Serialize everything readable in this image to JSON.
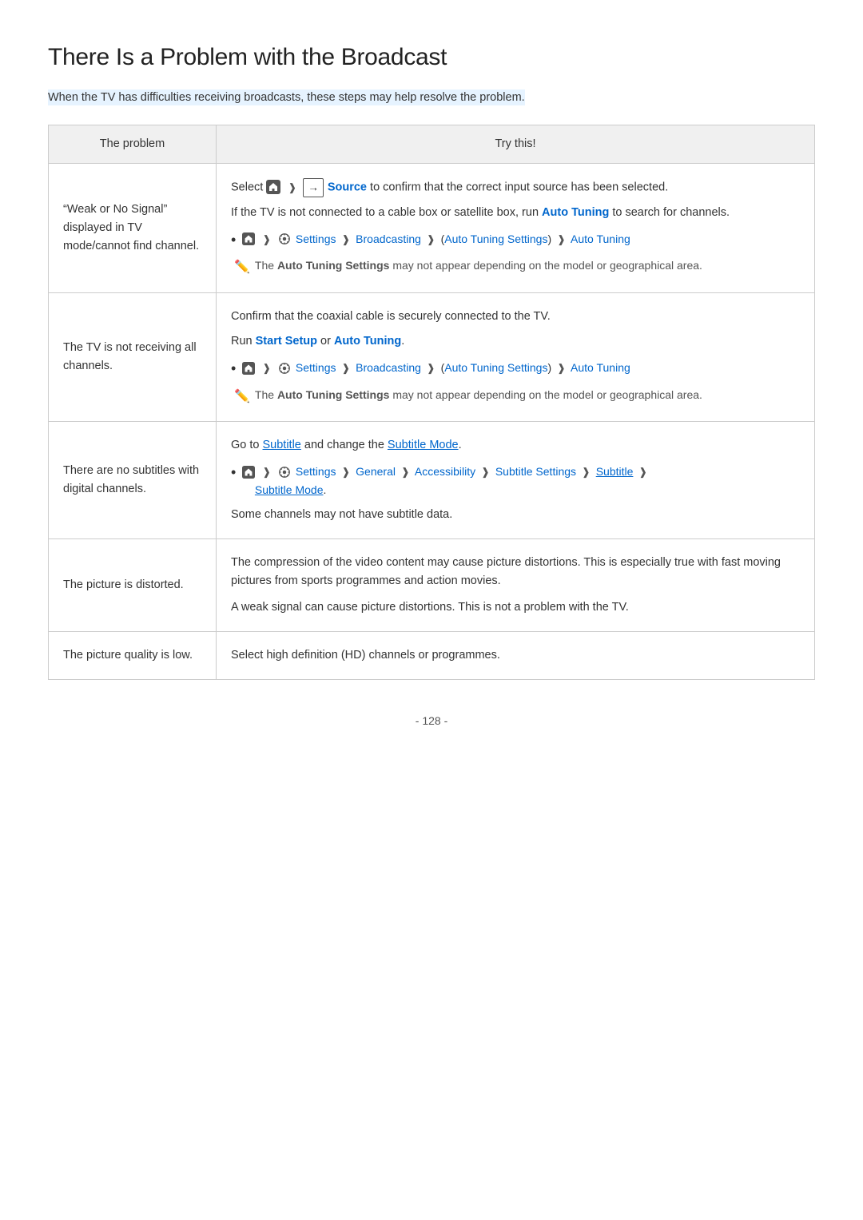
{
  "page": {
    "title": "There Is a Problem with the Broadcast",
    "intro": "When the TV has difficulties receiving broadcasts, these steps may help resolve the problem.",
    "table": {
      "col1_header": "The problem",
      "col2_header": "Try this!",
      "rows": [
        {
          "problem": "\"Weak or No Signal\" displayed in TV mode/cannot find channel.",
          "try_parts": [
            {
              "type": "text_with_links",
              "text": "Select [home] [source_box] Source to confirm that the correct input source has been selected."
            },
            {
              "type": "text",
              "text": "If the TV is not connected to a cable box or satellite box, run Auto Tuning to search for channels."
            },
            {
              "type": "nav",
              "path": "[home] > [settings] Settings > Broadcasting > (Auto Tuning Settings) > Auto Tuning"
            },
            {
              "type": "note",
              "text": "The Auto Tuning Settings may not appear depending on the model or geographical area."
            }
          ]
        },
        {
          "problem": "The TV is not receiving all channels.",
          "try_parts": [
            {
              "type": "text",
              "text": "Confirm that the coaxial cable is securely connected to the TV."
            },
            {
              "type": "text_link",
              "text": "Run Start Setup or Auto Tuning."
            },
            {
              "type": "nav",
              "path": "[home] > [settings] Settings > Broadcasting > (Auto Tuning Settings) > Auto Tuning"
            },
            {
              "type": "note",
              "text": "The Auto Tuning Settings may not appear depending on the model or geographical area."
            }
          ]
        },
        {
          "problem": "There are no subtitles with digital channels.",
          "try_parts": [
            {
              "type": "text_link2",
              "text": "Go to Subtitle and change the Subtitle Mode."
            },
            {
              "type": "nav2",
              "path": "[home] > [settings] Settings > General > Accessibility > Subtitle Settings > Subtitle > Subtitle Mode."
            },
            {
              "type": "text",
              "text": "Some channels may not have subtitle data."
            }
          ]
        },
        {
          "problem": "The picture is distorted.",
          "try_parts": [
            {
              "type": "text",
              "text": "The compression of the video content may cause picture distortions. This is especially true with fast moving pictures from sports programmes and action movies."
            },
            {
              "type": "text",
              "text": "A weak signal can cause picture distortions. This is not a problem with the TV."
            }
          ]
        },
        {
          "problem": "The picture quality is low.",
          "try_parts": [
            {
              "type": "text",
              "text": "Select high definition (HD) channels or programmes."
            }
          ]
        }
      ]
    },
    "footer": "- 128 -"
  }
}
